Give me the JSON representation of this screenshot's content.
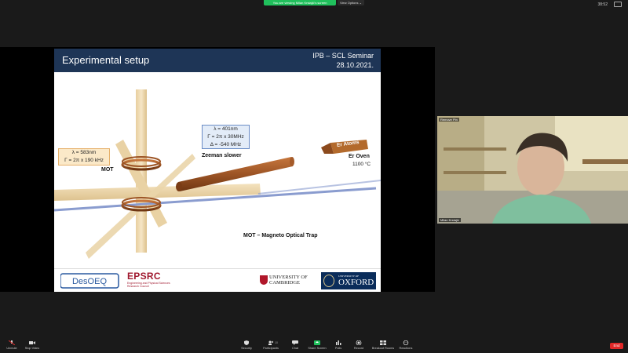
{
  "banner": {
    "sharing_text": "You are viewing Milan Krstajić's screen",
    "view_options": "View Options ⌄",
    "clock": "38:52"
  },
  "slide": {
    "title": "Experimental setup",
    "subtitle_line1": "IPB – SCL Seminar",
    "subtitle_line2": "28.10.2021.",
    "labels": {
      "mot": "MOT",
      "zeeman": "Zeeman slower",
      "er_oven": "Er Oven",
      "temperature": "1100 °C",
      "er_atoms": "Er Atoms",
      "mot_full": "MOT – Magneto Optical Trap"
    },
    "mot_box": [
      "λ = 583nm",
      "Γ = 2π x 190 kHz"
    ],
    "zeeman_box": [
      "λ = 401nm",
      "Γ = 2π x 30MHz",
      "Δ = -540 MHz"
    ],
    "footer": {
      "desoeq": "DesOEQ",
      "epsrc": "EPSRC",
      "epsrc_sub": "Engineering and Physical Sciences Research Council",
      "cambridge_line1": "UNIVERSITY OF",
      "cambridge_line2": "CAMBRIDGE",
      "oxford_small": "UNIVERSITY OF",
      "oxford_big": "OXFORD"
    }
  },
  "video": {
    "top_label": "Remove Pin",
    "name": "Milan Krstajić"
  },
  "toolbar": {
    "items": [
      {
        "label": "Unmute",
        "icon": "mic-muted-icon"
      },
      {
        "label": "Stop Video",
        "icon": "video-icon"
      },
      {
        "label": "Security",
        "icon": "shield-icon"
      },
      {
        "label": "Participants",
        "icon": "participants-icon"
      },
      {
        "label": "Chat",
        "icon": "chat-icon"
      },
      {
        "label": "Share Screen",
        "icon": "share-screen-icon"
      },
      {
        "label": "Polls",
        "icon": "polls-icon"
      },
      {
        "label": "Record",
        "icon": "record-icon"
      },
      {
        "label": "Breakout Rooms",
        "icon": "breakout-rooms-icon"
      },
      {
        "label": "Reactions",
        "icon": "reactions-icon"
      }
    ],
    "participant_count": "10",
    "end": "End"
  },
  "colors": {
    "header": "#1e3556",
    "share_green": "#20c05c",
    "end_red": "#e02828",
    "beam_blue": "#8a9ccf",
    "coil_brown": "#8b4a22"
  }
}
